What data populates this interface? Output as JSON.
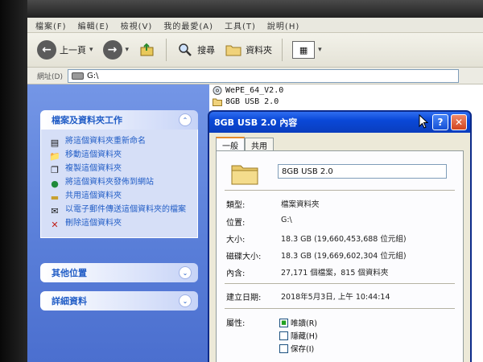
{
  "menu": {
    "items": [
      "檔案(F)",
      "編輯(E)",
      "檢視(V)",
      "我的最愛(A)",
      "工具(T)",
      "說明(H)"
    ]
  },
  "toolbar": {
    "back_label": "上一頁",
    "search_label": "搜尋",
    "folders_label": "資料夾"
  },
  "address": {
    "label": "網址(D)",
    "value": "G:\\"
  },
  "taskpane": {
    "file_tasks_title": "檔案及資料夾工作",
    "tasks": [
      "將這個資料夾重新命名",
      "移動這個資料夾",
      "複製這個資料夾",
      "將這個資料夾發佈到網站",
      "共用這個資料夾",
      "以電子郵件傳送這個資料夾的檔案",
      "刪除這個資料夾"
    ],
    "other_places_title": "其他位置",
    "details_title": "詳細資料"
  },
  "files": [
    {
      "name": "WePE_64_V2.0",
      "icon": "disc-icon"
    },
    {
      "name": "8GB USB 2.0",
      "icon": "folder-icon"
    }
  ],
  "dialog": {
    "title": "8GB USB 2.0 內容",
    "tabs": [
      "一般",
      "共用"
    ],
    "folder_name": "8GB USB 2.0",
    "type_label": "類型:",
    "type_value": "檔案資料夾",
    "location_label": "位置:",
    "location_value": "G:\\",
    "size_label": "大小:",
    "size_value": "18.3 GB (19,660,453,688 位元組)",
    "disk_size_label": "磁碟大小:",
    "disk_size_value": "18.3 GB (19,669,602,304 位元組)",
    "contains_label": "內含:",
    "contains_value": "27,171 個檔案，815 個資料夾",
    "created_label": "建立日期:",
    "created_value": "2018年5月3日, 上午 10:44:14",
    "attributes_label": "屬性:",
    "attr_readonly": "唯讀(R)",
    "attr_hidden": "隱藏(H)",
    "attr_archive": "保存(I)"
  },
  "colors": {
    "xp_blue_title": "#0a48d8",
    "taskpane_blue": "#5a7fd9",
    "link_blue": "#215dc6"
  }
}
